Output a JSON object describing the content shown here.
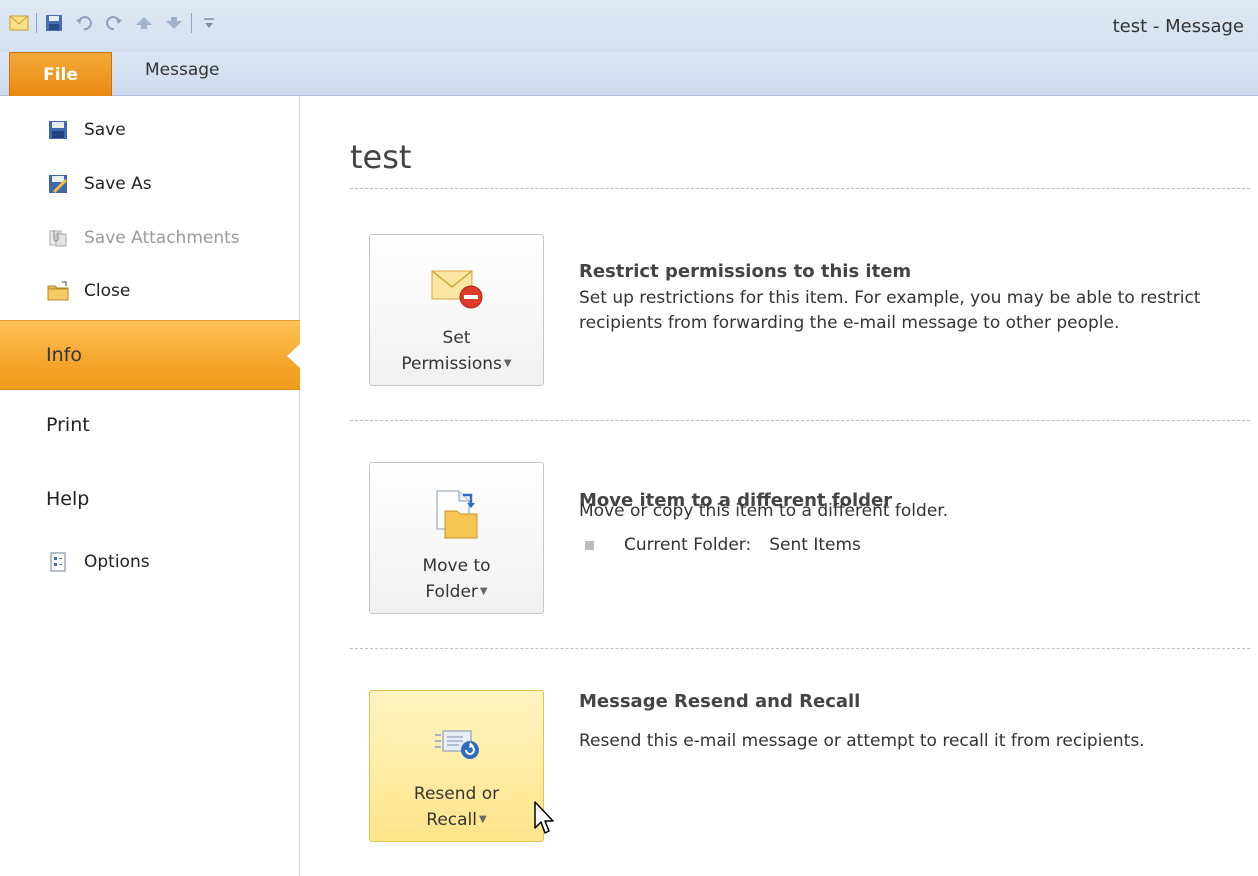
{
  "window": {
    "title": "test - Message"
  },
  "ribbon": {
    "file_tab": "File",
    "message_tab": "Message"
  },
  "nav": {
    "save": "Save",
    "save_as": "Save As",
    "save_attachments": "Save Attachments",
    "close": "Close",
    "info": "Info",
    "print": "Print",
    "help": "Help",
    "options": "Options"
  },
  "content": {
    "title": "test",
    "sections": [
      {
        "button_line1": "Set",
        "button_line2": "Permissions",
        "title": "Restrict permissions to this item",
        "description": "Set up restrictions for this item. For example, you may be able to restrict recipients from forwarding the e-mail message to other people."
      },
      {
        "button_line1": "Move to",
        "button_line2": "Folder",
        "title": "Move item to a different folder",
        "description": "Move or copy this item to a different folder.",
        "bullet_label": "Current Folder:",
        "bullet_value": "Sent Items"
      },
      {
        "button_line1": "Resend or",
        "button_line2": "Recall",
        "title": "Message Resend and Recall",
        "description": "Resend this e-mail message or attempt to recall it from recipients."
      }
    ]
  },
  "colors": {
    "accent_orange": "#f5a52b",
    "hover_yellow": "#ffe58a",
    "ribbon_blue": "#d3e0f0"
  }
}
